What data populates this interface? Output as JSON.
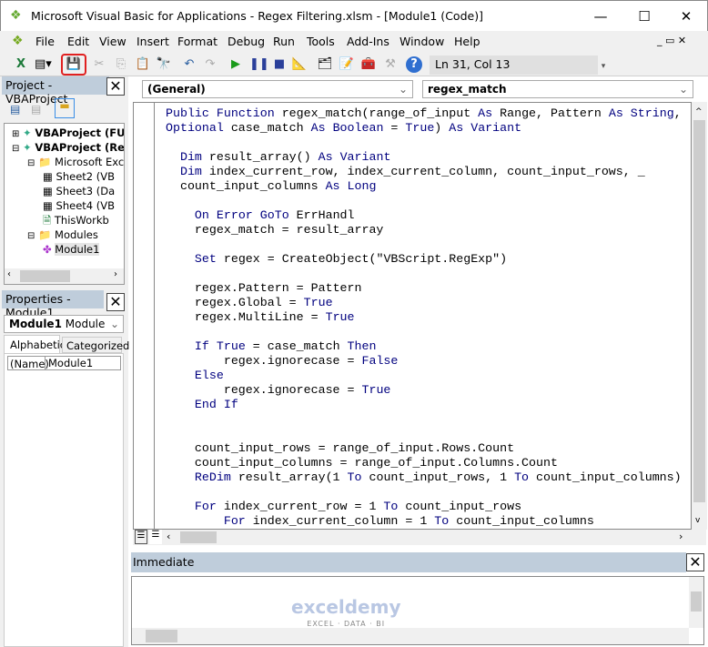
{
  "window": {
    "title": "Microsoft Visual Basic for Applications - Regex Filtering.xlsm - [Module1 (Code)]"
  },
  "menu": [
    "File",
    "Edit",
    "View",
    "Insert",
    "Format",
    "Debug",
    "Run",
    "Tools",
    "Add-Ins",
    "Window",
    "Help"
  ],
  "toolbar": {
    "status": "Ln 31, Col 13",
    "highlighted": "save-button",
    "highlight_color": "#e02020"
  },
  "project": {
    "title": "Project - VBAProject",
    "nodes": [
      {
        "label": "VBAProject (FUN",
        "bold": true,
        "level": 0,
        "icon": "vba-project-icon"
      },
      {
        "label": "VBAProject (Reg",
        "bold": true,
        "level": 0,
        "icon": "vba-project-icon"
      },
      {
        "label": "Microsoft Exce",
        "level": 1,
        "icon": "folder-icon"
      },
      {
        "label": "Sheet2 (VB",
        "level": 2,
        "icon": "sheet-icon"
      },
      {
        "label": "Sheet3 (Da",
        "level": 2,
        "icon": "sheet-icon"
      },
      {
        "label": "Sheet4 (VB",
        "level": 2,
        "icon": "sheet-icon"
      },
      {
        "label": "ThisWorkb",
        "level": 2,
        "icon": "workbook-icon"
      },
      {
        "label": "Modules",
        "level": 1,
        "icon": "folder-icon"
      },
      {
        "label": "Module1",
        "level": 2,
        "icon": "module-icon",
        "selected": true
      }
    ]
  },
  "properties": {
    "title": "Properties - Module1",
    "object": "Module1",
    "type": "Module",
    "tabs": [
      "Alphabetic",
      "Categorized"
    ],
    "row": {
      "name": "(Name)",
      "value": "Module1"
    }
  },
  "code": {
    "object": "(General)",
    "procedure": "regex_match",
    "keywords": [
      "Public",
      "Function",
      "As",
      "Optional",
      "Boolean",
      "True",
      "False",
      "Variant",
      "Dim",
      "Long",
      "On",
      "Error",
      "GoTo",
      "Set",
      "If",
      "Then",
      "Else",
      "End",
      "ReDim",
      "To",
      "For",
      "String"
    ],
    "lines": [
      "Public Function regex_match(range_of_input As Range, Pattern As String,",
      "Optional case_match As Boolean = True) As Variant",
      "",
      "  Dim result_array() As Variant",
      "  Dim index_current_row, index_current_column, count_input_rows, _",
      "  count_input_columns As Long",
      "",
      "    On Error GoTo ErrHandl",
      "    regex_match = result_array",
      "",
      "    Set regex = CreateObject(\"VBScript.RegExp\")",
      "",
      "    regex.Pattern = Pattern",
      "    regex.Global = True",
      "    regex.MultiLine = True",
      "",
      "    If True = case_match Then",
      "        regex.ignorecase = False",
      "    Else",
      "        regex.ignorecase = True",
      "    End If",
      "",
      "",
      "    count_input_rows = range_of_input.Rows.Count",
      "    count_input_columns = range_of_input.Columns.Count",
      "    ReDim result_array(1 To count_input_rows, 1 To count_input_columns)",
      "",
      "    For index_current_row = 1 To count_input_rows",
      "        For index_current_column = 1 To count_input_columns"
    ]
  },
  "immediate": {
    "title": "Immediate"
  },
  "watermark": {
    "name": "exceldemy",
    "tag": "EXCEL · DATA · BI"
  }
}
